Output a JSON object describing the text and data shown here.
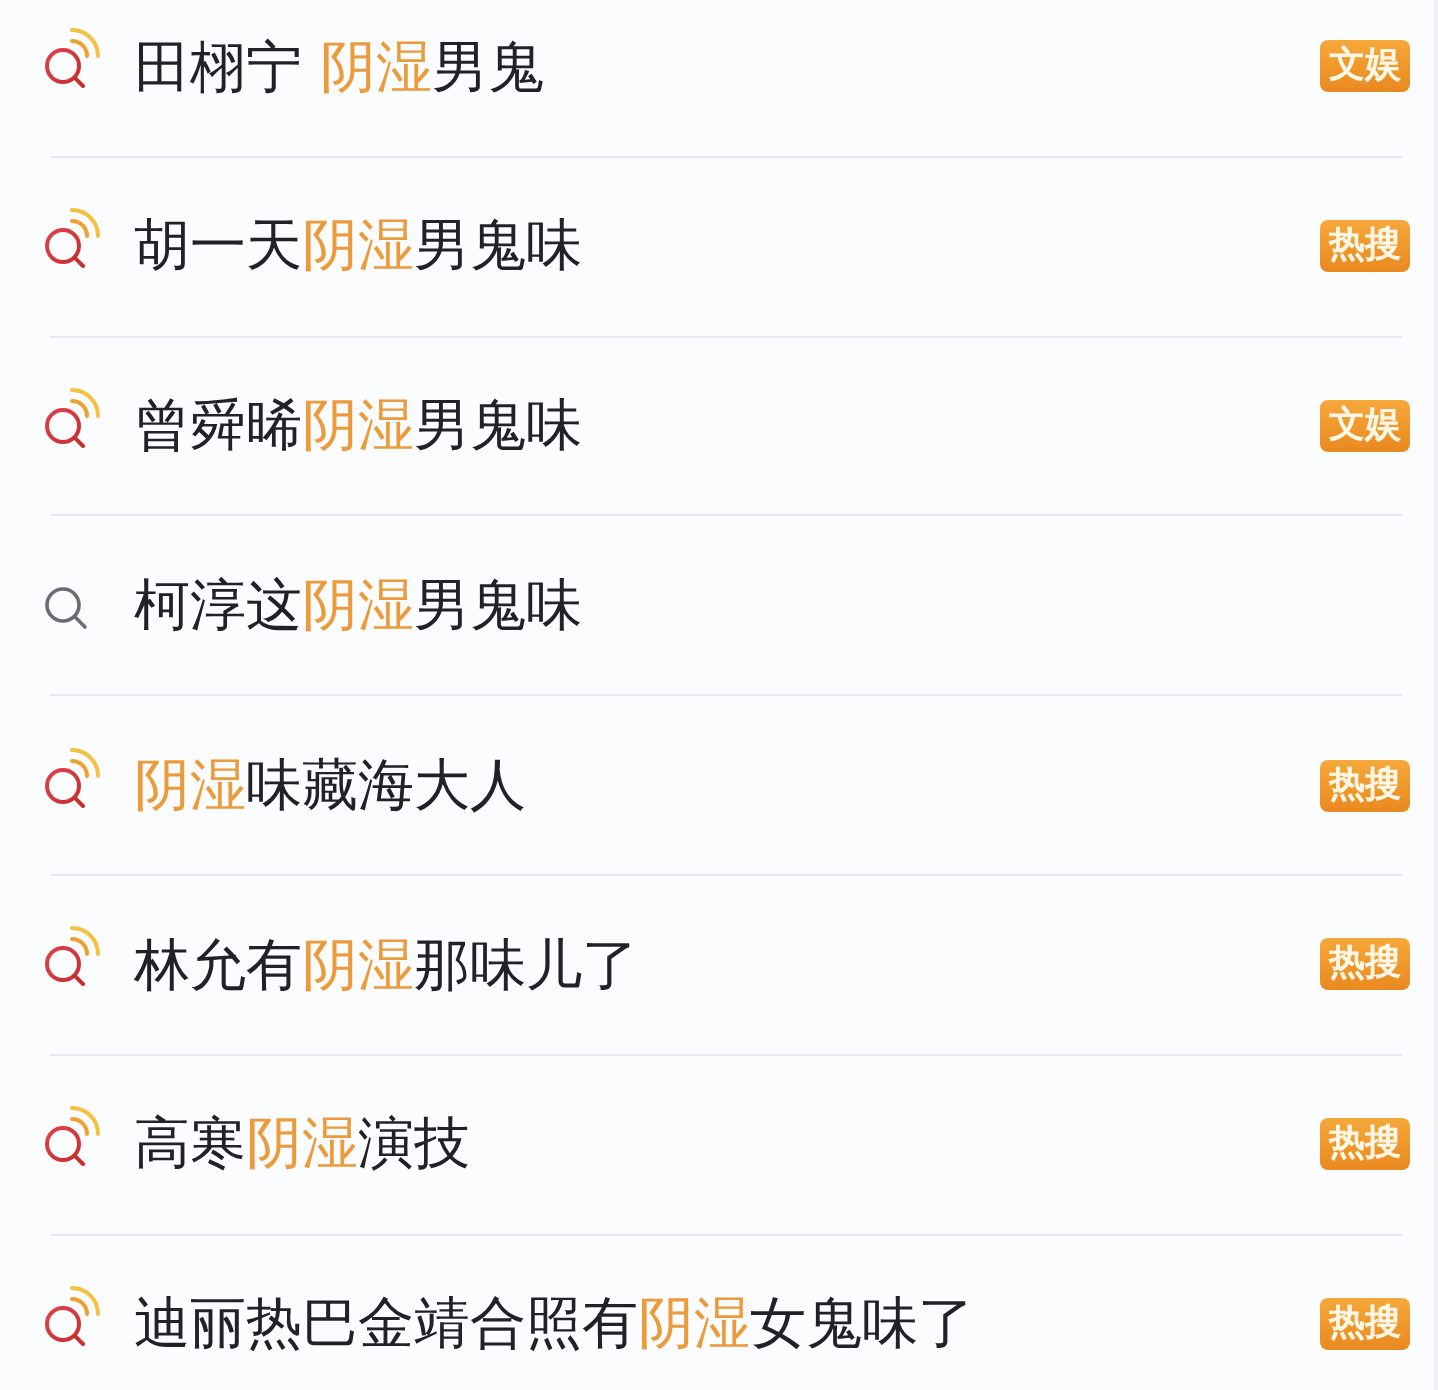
{
  "suggestions": [
    {
      "kind": "hot",
      "segments": [
        {
          "text": "田栩宁 ",
          "highlight": false
        },
        {
          "text": "阴湿",
          "highlight": true
        },
        {
          "text": "男鬼",
          "highlight": false
        }
      ],
      "tag": "文娱"
    },
    {
      "kind": "hot",
      "segments": [
        {
          "text": "胡一天",
          "highlight": false
        },
        {
          "text": "阴湿",
          "highlight": true
        },
        {
          "text": "男鬼味",
          "highlight": false
        }
      ],
      "tag": "热搜"
    },
    {
      "kind": "hot",
      "segments": [
        {
          "text": "曾舜晞",
          "highlight": false
        },
        {
          "text": "阴湿",
          "highlight": true
        },
        {
          "text": "男鬼味",
          "highlight": false
        }
      ],
      "tag": "文娱"
    },
    {
      "kind": "plain",
      "segments": [
        {
          "text": "柯淳这",
          "highlight": false
        },
        {
          "text": "阴湿",
          "highlight": true
        },
        {
          "text": "男鬼味",
          "highlight": false
        }
      ]
    },
    {
      "kind": "hot",
      "segments": [
        {
          "text": "阴湿",
          "highlight": true
        },
        {
          "text": "味藏海大人",
          "highlight": false
        }
      ],
      "tag": "热搜"
    },
    {
      "kind": "hot",
      "segments": [
        {
          "text": "林允有",
          "highlight": false
        },
        {
          "text": "阴湿",
          "highlight": true
        },
        {
          "text": "那味儿了",
          "highlight": false
        }
      ],
      "tag": "热搜"
    },
    {
      "kind": "hot",
      "segments": [
        {
          "text": "高寒",
          "highlight": false
        },
        {
          "text": "阴湿",
          "highlight": true
        },
        {
          "text": "演技",
          "highlight": false
        }
      ],
      "tag": "热搜"
    },
    {
      "kind": "hot",
      "segments": [
        {
          "text": "迪丽热巴金靖合照有",
          "highlight": false
        },
        {
          "text": "阴湿",
          "highlight": true
        },
        {
          "text": "女鬼味了",
          "highlight": false
        }
      ],
      "tag": "热搜"
    }
  ]
}
